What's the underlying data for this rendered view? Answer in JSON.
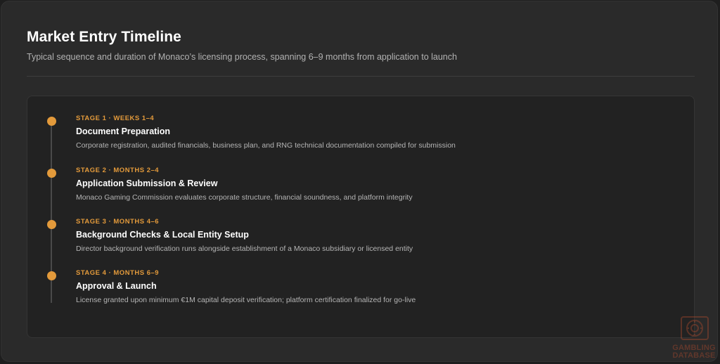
{
  "header": {
    "title": "Market Entry Timeline",
    "subtitle": "Typical sequence and duration of Monaco’s licensing process, spanning 6–9 months from application to launch"
  },
  "stages": [
    {
      "label": "STAGE 1 · WEEKS 1–4",
      "title": "Document Preparation",
      "description": "Corporate registration, audited financials, business plan, and RNG technical documentation compiled for submission"
    },
    {
      "label": "STAGE 2 · MONTHS 2–4",
      "title": "Application Submission & Review",
      "description": "Monaco Gaming Commission evaluates corporate structure, financial soundness, and platform integrity"
    },
    {
      "label": "STAGE 3 · MONTHS 4–6",
      "title": "Background Checks & Local Entity Setup",
      "description": "Director background verification runs alongside establishment of a Monaco subsidiary or licensed entity"
    },
    {
      "label": "STAGE 4 · MONTHS 6–9",
      "title": "Approval & Launch",
      "description": "License granted upon minimum €1M capital deposit verification; platform certification finalized for go-live"
    }
  ],
  "colors": {
    "accent": "#e39a3b",
    "background": "#2a2a2a",
    "card": "#222222"
  },
  "watermark": {
    "line1": "GAMBLING",
    "line2": "DATABASE"
  }
}
